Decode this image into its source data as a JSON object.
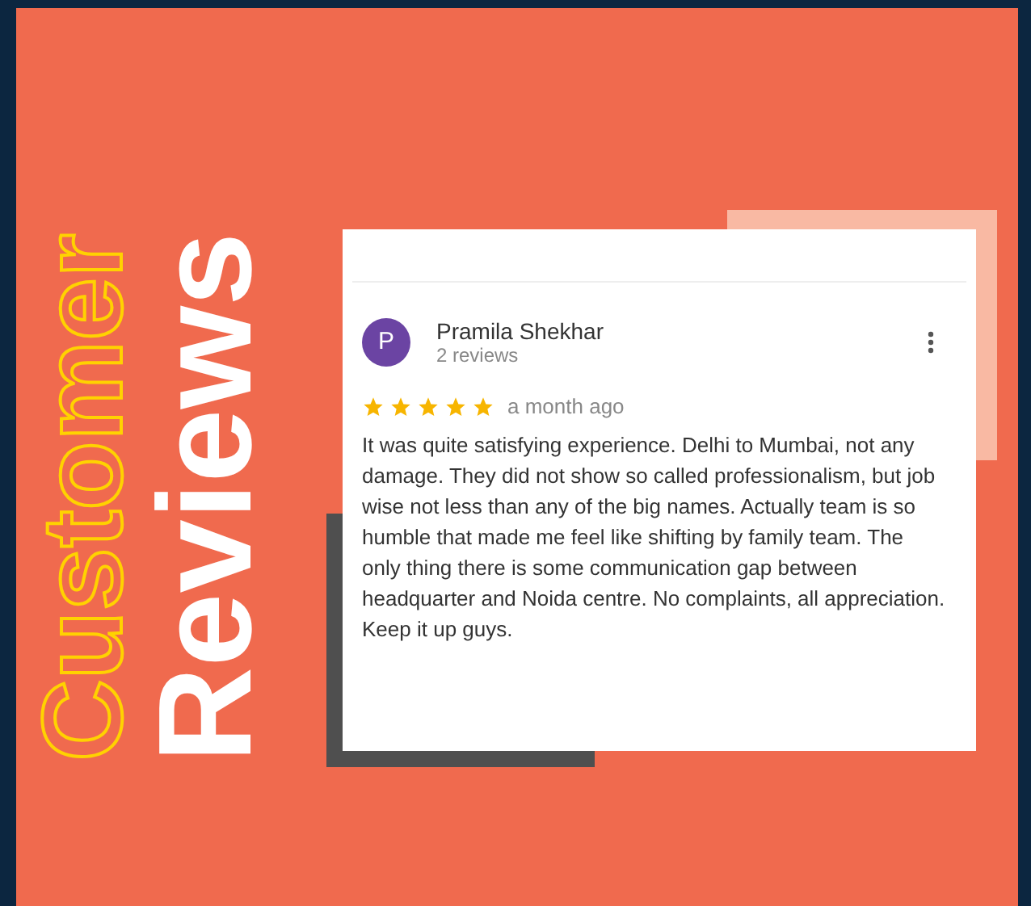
{
  "title": [
    {
      "text": "Customer",
      "kind": "outline"
    },
    {
      "text": "Reviews",
      "kind": "solid"
    }
  ],
  "review": {
    "avatar_letter": "P",
    "name": "Pramila Shekhar",
    "meta": "2 reviews",
    "stars": 5,
    "time": "a month ago",
    "text": "It was quite satisfying experience. Delhi to Mumbai, not any damage. They did not show so called professionalism, but job wise not less than any of the big names. Actually team is so humble that made me feel like shifting by family team. The only thing there is some communication gap between headquarter and Noida centre. No complaints, all appreciation.  Keep it up guys."
  }
}
